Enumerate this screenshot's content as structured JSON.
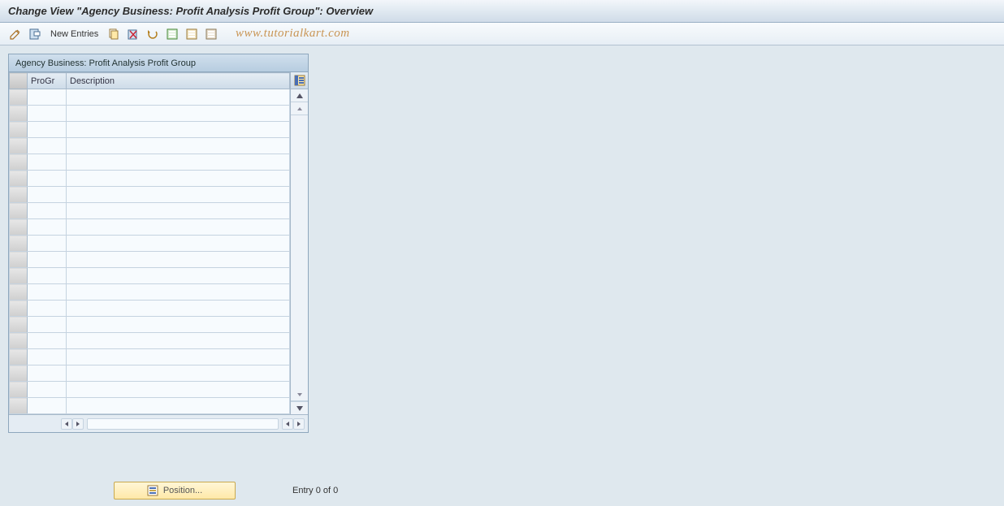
{
  "title": "Change View \"Agency Business: Profit Analysis Profit Group\": Overview",
  "watermark": "www.tutorialkart.com",
  "toolbar": {
    "new_entries_label": "New Entries"
  },
  "panel": {
    "title": "Agency Business: Profit Analysis Profit Group",
    "columns": {
      "progr": "ProGr",
      "description": "Description"
    },
    "rows": 20
  },
  "footer": {
    "position_label": "Position...",
    "entry_text": "Entry 0 of 0"
  }
}
